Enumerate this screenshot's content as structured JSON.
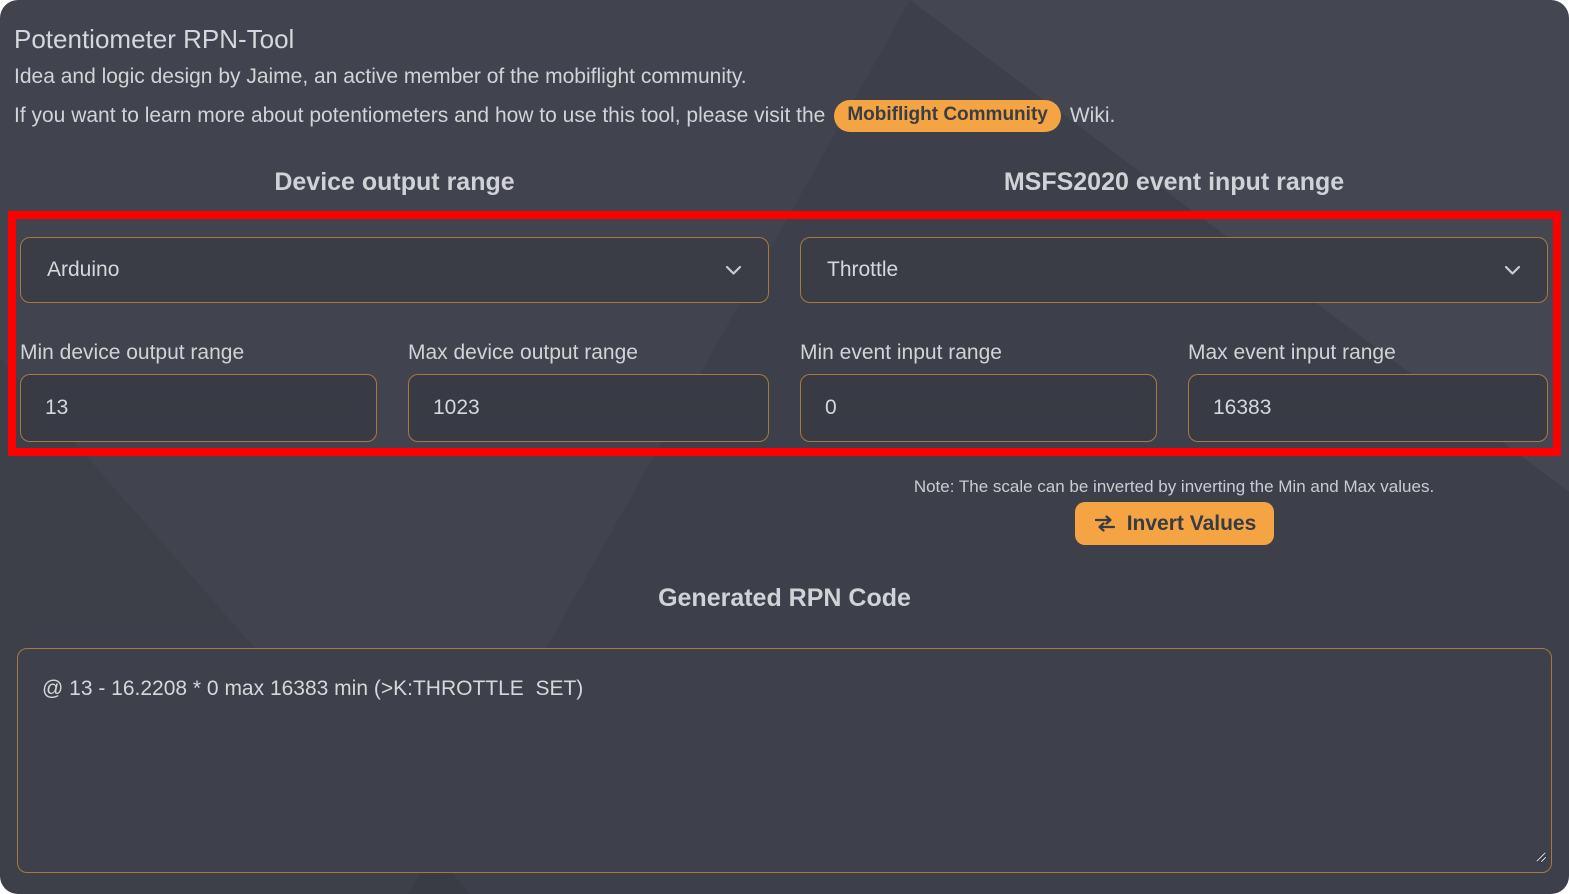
{
  "page": {
    "title": "Potentiometer RPN-Tool",
    "subtitle": "Idea and logic design by Jaime, an active member of the mobiflight community.",
    "info_prefix": "If you want to learn more about potentiometers and how to use this tool, please visit the",
    "info_badge": "Mobiflight Community",
    "info_suffix": "Wiki."
  },
  "device_section": {
    "heading": "Device output range",
    "select_value": "Arduino",
    "min_label": "Min device output range",
    "min_value": "13",
    "max_label": "Max device output range",
    "max_value": "1023"
  },
  "event_section": {
    "heading": "MSFS2020 event input range",
    "select_value": "Throttle",
    "min_label": "Min event input range",
    "min_value": "0",
    "max_label": "Max event input range",
    "max_value": "16383",
    "note": "Note: The scale can be inverted by inverting the Min and Max values.",
    "invert_button_label": "Invert Values"
  },
  "output_section": {
    "heading": "Generated RPN Code",
    "code": "@ 13 - 16.2208 * 0 max 16383 min (>K:THROTTLE  SET)"
  },
  "icons": {
    "device_select_chevron": "chevron-down-icon",
    "event_select_chevron": "chevron-down-icon",
    "invert_button_icon": "swap-arrows-icon",
    "textarea_corner": "resize-handle-icon"
  },
  "colors": {
    "accent_orange": "#f4a442",
    "field_border_orange": "#a8783e",
    "highlight_red": "#fe0000",
    "page_background": "#41444e",
    "field_background": "#383b44",
    "text_light": "#d4d5d8",
    "badge_text_dark": "#3a3d45"
  }
}
